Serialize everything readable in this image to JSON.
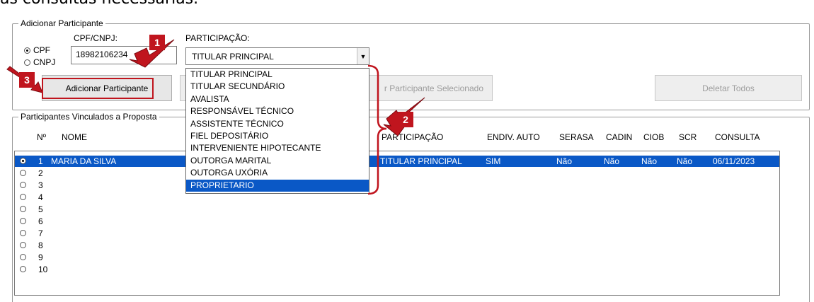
{
  "caption": "as consultas necessárias.",
  "add_group": {
    "legend": "Adicionar Participante",
    "radio_cpf": "CPF",
    "radio_cnpj": "CNPJ",
    "cpf_label": "CPF/CNPJ:",
    "cpf_value": "18982106234",
    "participacao_label": "PARTICIPAÇÃO:",
    "participacao_value": "TITULAR PRINCIPAL",
    "add_button": "Adicionar Participante",
    "delete_selected_button": "r Participante Selecionado",
    "delete_all_button": "Deletar Todos"
  },
  "dropdown_options": [
    "TITULAR PRINCIPAL",
    "TITULAR SECUNDÁRIO",
    "AVALISTA",
    "RESPONSÁVEL TÉCNICO",
    "ASSISTENTE TÉCNICO",
    "FIEL DEPOSITÁRIO",
    "INTERVENIENTE HIPOTECANTE",
    "OUTORGA MARITAL",
    "OUTORGA UXÓRIA",
    "PROPRIETARIO"
  ],
  "dropdown_selected": "PROPRIETARIO",
  "linked_group": {
    "legend": "Participantes Vinculados a Proposta",
    "columns": {
      "num": "Nº",
      "name": "NOME",
      "participacao": "PARTICIPAÇÃO",
      "endiv": "ENDIV. AUTO",
      "serasa": "SERASA",
      "cadin": "CADIN",
      "ciob": "CIOB",
      "scr": "SCR",
      "consulta": "CONSULTA"
    },
    "rows": [
      {
        "num": "1",
        "name": "MARIA DA SILVA",
        "participacao": "TITULAR PRINCIPAL",
        "endiv": "SIM",
        "serasa": "Não",
        "cadin": "Não",
        "ciob": "Não",
        "scr": "Não",
        "consulta": "06/11/2023"
      },
      {
        "num": "2",
        "name": "",
        "participacao": "",
        "endiv": "",
        "serasa": "",
        "cadin": "",
        "ciob": "",
        "scr": "",
        "consulta": ""
      },
      {
        "num": "3",
        "name": "",
        "participacao": "",
        "endiv": "",
        "serasa": "",
        "cadin": "",
        "ciob": "",
        "scr": "",
        "consulta": ""
      },
      {
        "num": "4",
        "name": "",
        "participacao": "",
        "endiv": "",
        "serasa": "",
        "cadin": "",
        "ciob": "",
        "scr": "",
        "consulta": ""
      },
      {
        "num": "5",
        "name": "",
        "participacao": "",
        "endiv": "",
        "serasa": "",
        "cadin": "",
        "ciob": "",
        "scr": "",
        "consulta": ""
      },
      {
        "num": "6",
        "name": "",
        "participacao": "",
        "endiv": "",
        "serasa": "",
        "cadin": "",
        "ciob": "",
        "scr": "",
        "consulta": ""
      },
      {
        "num": "7",
        "name": "",
        "participacao": "",
        "endiv": "",
        "serasa": "",
        "cadin": "",
        "ciob": "",
        "scr": "",
        "consulta": ""
      },
      {
        "num": "8",
        "name": "",
        "participacao": "",
        "endiv": "",
        "serasa": "",
        "cadin": "",
        "ciob": "",
        "scr": "",
        "consulta": ""
      },
      {
        "num": "9",
        "name": "",
        "participacao": "",
        "endiv": "",
        "serasa": "",
        "cadin": "",
        "ciob": "",
        "scr": "",
        "consulta": ""
      },
      {
        "num": "10",
        "name": "",
        "participacao": "",
        "endiv": "",
        "serasa": "",
        "cadin": "",
        "ciob": "",
        "scr": "",
        "consulta": ""
      }
    ]
  },
  "callouts": [
    "1",
    "2",
    "3"
  ],
  "colors": {
    "selection": "#0a58c6",
    "annotation_red": "#c0151e",
    "border": "#9a9a9a"
  }
}
